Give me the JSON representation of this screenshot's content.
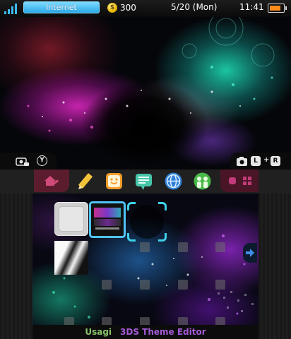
{
  "status_bar": {
    "wifi_label": "Internet",
    "coin_icon": "play-coin-icon",
    "coins": "300",
    "date": "5/20 (Mon)",
    "time": "11:41",
    "battery_level": 0.85
  },
  "top_controls": {
    "left_button": "Y",
    "shoulder_l": "L",
    "plus": "+",
    "shoulder_r": "R"
  },
  "toolbar": {
    "settings_icon": "home-wrench-icon",
    "applets": [
      {
        "name": "notes-pencil-icon",
        "color": "#f0c33a"
      },
      {
        "name": "friends-smiley-icon",
        "color": "#f39c2a"
      },
      {
        "name": "notifications-icon",
        "color": "#46c5a9"
      },
      {
        "name": "internet-globe-icon",
        "color": "#2f7fd6"
      },
      {
        "name": "miiverse-icon",
        "color": "#48b848"
      }
    ]
  },
  "footer": {
    "author": "Usagi",
    "editor": "3DS Theme Editor"
  },
  "colors": {
    "accent_cyan": "#4fc3f7",
    "footer_author": "#86c16a",
    "footer_editor": "#a45ad6"
  }
}
